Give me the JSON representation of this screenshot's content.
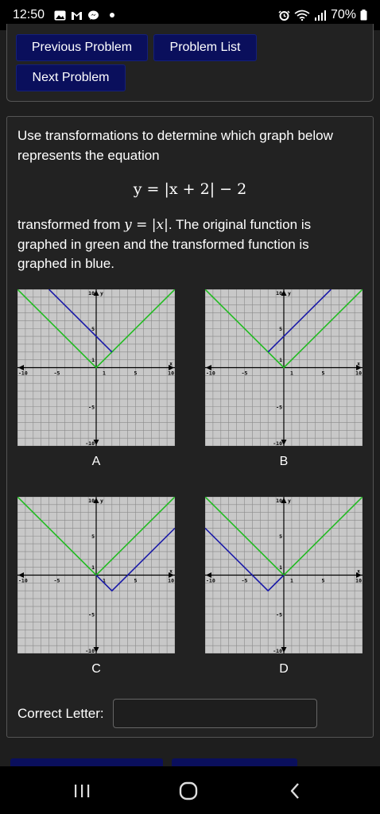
{
  "status_bar": {
    "time": "12:50",
    "battery": "70%",
    "left_icons": [
      "gallery-icon",
      "gmail-icon",
      "messenger-icon",
      "dot-icon"
    ],
    "right_icons": [
      "alarm-icon",
      "wifi-icon",
      "signal-icon",
      "battery-icon"
    ]
  },
  "nav": {
    "previous_label": "Previous Problem",
    "list_label": "Problem List",
    "next_label": "Next Problem"
  },
  "problem": {
    "intro": "Use transformations to determine which graph below represents the equation",
    "equation": "y = |x + 2| − 2",
    "transformed_prefix": "transformed from ",
    "base_function": "y = |x|",
    "transformed_suffix": ". The original function is graphed in green and the transformed function is graphed in blue."
  },
  "graphs": [
    {
      "label": "A",
      "green_vertex": [
        0,
        0
      ],
      "blue_vertex": [
        2,
        2
      ],
      "blue_range": [
        -6,
        2
      ]
    },
    {
      "label": "B",
      "green_vertex": [
        0,
        0
      ],
      "blue_vertex": [
        -2,
        2
      ],
      "blue_range": [
        -2,
        6
      ]
    },
    {
      "label": "C",
      "green_vertex": [
        0,
        0
      ],
      "blue_vertex": [
        2,
        -2
      ],
      "blue_range": [
        0,
        10
      ]
    },
    {
      "label": "D",
      "green_vertex": [
        0,
        0
      ],
      "blue_vertex": [
        -2,
        -2
      ],
      "blue_range": [
        -10,
        0
      ]
    }
  ],
  "graph_axis": {
    "xmin": -10,
    "xmax": 10,
    "ymin": -10,
    "ymax": 10,
    "x_tick_labels": [
      "-10",
      "-5",
      "1",
      "5",
      "10"
    ],
    "y_tick_labels": [
      "10",
      "5",
      "1",
      "-5",
      "-10"
    ],
    "x_axis_name": "x",
    "y_axis_name": "y",
    "green_color": "#22bb22",
    "blue_color": "#1a1aa8"
  },
  "answer": {
    "label": "Correct Letter:",
    "value": "",
    "placeholder": ""
  },
  "colors": {
    "button_bg": "#0a0f5c",
    "card_bg": "#222222",
    "page_bg": "#1e1e1e"
  }
}
